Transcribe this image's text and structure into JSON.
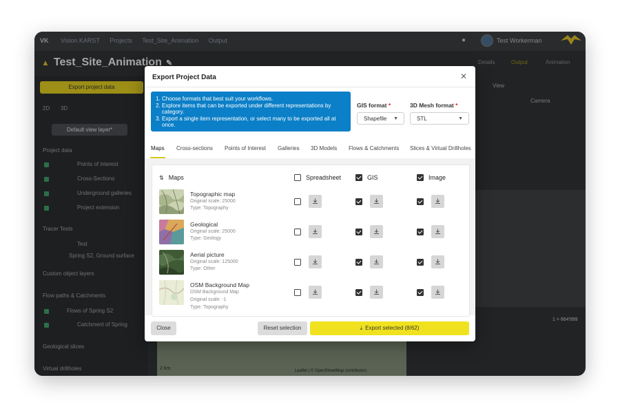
{
  "app": {
    "nav": [
      "Vision KARST",
      "Projects",
      "Test_Site_Animation",
      "Output"
    ],
    "user_name": "Test Workerman",
    "project_title": "Test_Site_Animation",
    "right_tabs": [
      "Details",
      "Output",
      "Animation"
    ],
    "view_label": "View",
    "camera_label": "Camera",
    "sidebar": {
      "export_button": "Export project data",
      "view_2d": "2D",
      "view_3d": "3D",
      "default_layer": "Default view layer*",
      "project_data": "Project data",
      "items": [
        "Points of interest",
        "Cross-Sections",
        "Underground galleries",
        "Project extension"
      ],
      "tracer_tests": "Tracer Tests",
      "tracer_items": [
        "Test",
        "Spring S2, Ground surface"
      ],
      "custom_layers": "Custom object layers",
      "flow_paths": "Flow paths & Catchments",
      "flow_items": [
        "Flows of Spring S2",
        "Catchment of Spring"
      ],
      "geological_slices": "Geological slices",
      "virtual_drillholes": "Virtual drillholes"
    },
    "map_attribution": "Leaflet | © OpenStreetMap contributors",
    "scale_text": "2 km",
    "coords_text": "1 = 664'999"
  },
  "modal": {
    "title": "Export Project Data",
    "instructions": [
      "Choose formats that best suit your workflows.",
      "Explore items that can be exported under different representations by category.",
      "Export a single item representation, or select many to be exported all at once."
    ],
    "gis_format_label": "GIS format",
    "gis_format_value": "Shapefile",
    "mesh_format_label": "3D Mesh format",
    "mesh_format_value": "STL",
    "required_mark": "*",
    "tabs": [
      "Maps",
      "Cross-sections",
      "Points of Interest",
      "Galleries",
      "3D Models",
      "Flows & Catchments",
      "Slices & Virtual Drillholes"
    ],
    "section_title": "Maps",
    "columns": {
      "spreadsheet": "Spreadsheet",
      "gis": "GIS",
      "image": "Image"
    },
    "rows": [
      {
        "name": "Topographic map",
        "line1": "Original scale: 25000",
        "line2": "Type: Topography",
        "line3": ""
      },
      {
        "name": "Geological",
        "line1": "Original scale: 25000",
        "line2": "Type: Geology",
        "line3": ""
      },
      {
        "name": "Aerial picture",
        "line1": "Original scale: 125000",
        "line2": "Type: Other",
        "line3": ""
      },
      {
        "name": "OSM Background Map",
        "line1": "OSM Background Map",
        "line2": "Original scale: -1",
        "line3": "Type: Topography"
      }
    ],
    "close_button": "Close",
    "reset_button": "Reset selection",
    "export_button": "Export selected (8/62)"
  }
}
